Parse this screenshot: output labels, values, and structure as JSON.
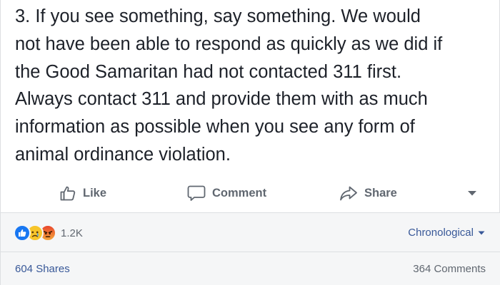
{
  "post": {
    "text_lines": [
      "3. If you see something, say something. We would",
      "not have been able to respond as quickly as we did if",
      "the Good Samaritan had not contacted 311 first.",
      "Always contact 311 and provide them with as much",
      "information as possible when you see any form of",
      "animal ordinance violation."
    ]
  },
  "actions": {
    "like_label": "Like",
    "comment_label": "Comment",
    "share_label": "Share",
    "like_icon": "thumbs-up-icon",
    "comment_icon": "speech-bubble-icon",
    "share_icon": "share-arrow-icon",
    "more_icon": "caret-down-icon"
  },
  "reactions": {
    "types": [
      "like",
      "sad",
      "angry"
    ],
    "count": "1.2K"
  },
  "sort": {
    "label": "Chronological"
  },
  "footer": {
    "shares": "604 Shares",
    "comments": "364 Comments"
  },
  "colors": {
    "link": "#385898",
    "muted": "#606770",
    "like_blue": "#1877f2",
    "divider": "#dddfe2",
    "footer_bg": "#f5f6f7"
  }
}
